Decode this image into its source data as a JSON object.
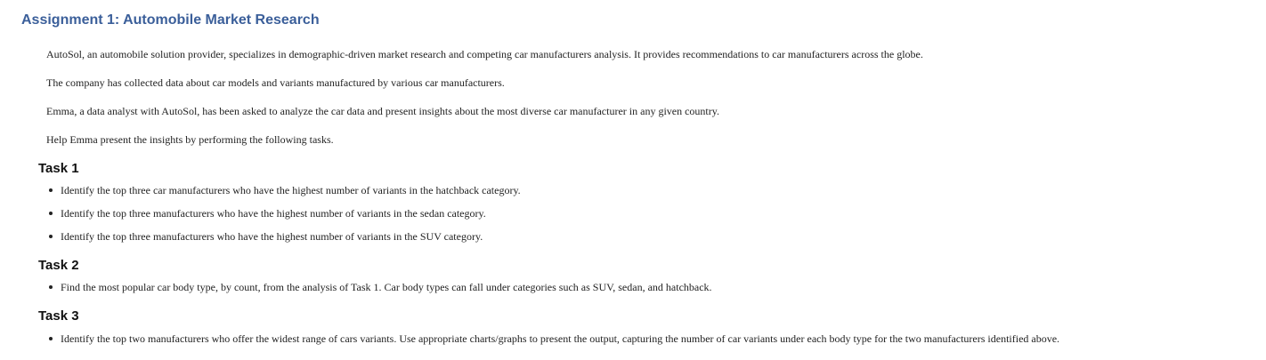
{
  "title": "Assignment 1: Automobile Market Research",
  "intro": [
    "AutoSol, an automobile solution provider, specializes in demographic-driven market research and competing car manufacturers analysis. It provides recommendations to car manufacturers across the globe.",
    "The company has collected data about car models and variants manufactured by various car manufacturers.",
    "Emma, a data analyst with AutoSol, has been asked to analyze the car data and present insights about the most diverse car manufacturer in any given country.",
    "Help Emma present the insights by performing the following tasks."
  ],
  "tasks": [
    {
      "heading": "Task 1",
      "items": [
        "Identify the top three car manufacturers who have the highest number of variants in the hatchback category.",
        "Identify the top three manufacturers who have the highest number of variants in the sedan category.",
        "Identify the top three manufacturers who have the highest number of variants in the SUV category."
      ]
    },
    {
      "heading": "Task 2",
      "items": [
        "Find the most popular car body type, by count, from the analysis of Task 1. Car body types can fall under categories such as SUV, sedan, and hatchback."
      ]
    },
    {
      "heading": "Task 3",
      "items": [
        "Identify the top two manufacturers who offer the widest range of cars variants. Use appropriate charts/graphs to present the output, capturing the number of car variants under each body type for the two manufacturers identified above."
      ]
    }
  ],
  "colors": {
    "title": "#3b5f9a",
    "body_text": "#222222",
    "heading_text": "#111111",
    "background": "#ffffff"
  }
}
